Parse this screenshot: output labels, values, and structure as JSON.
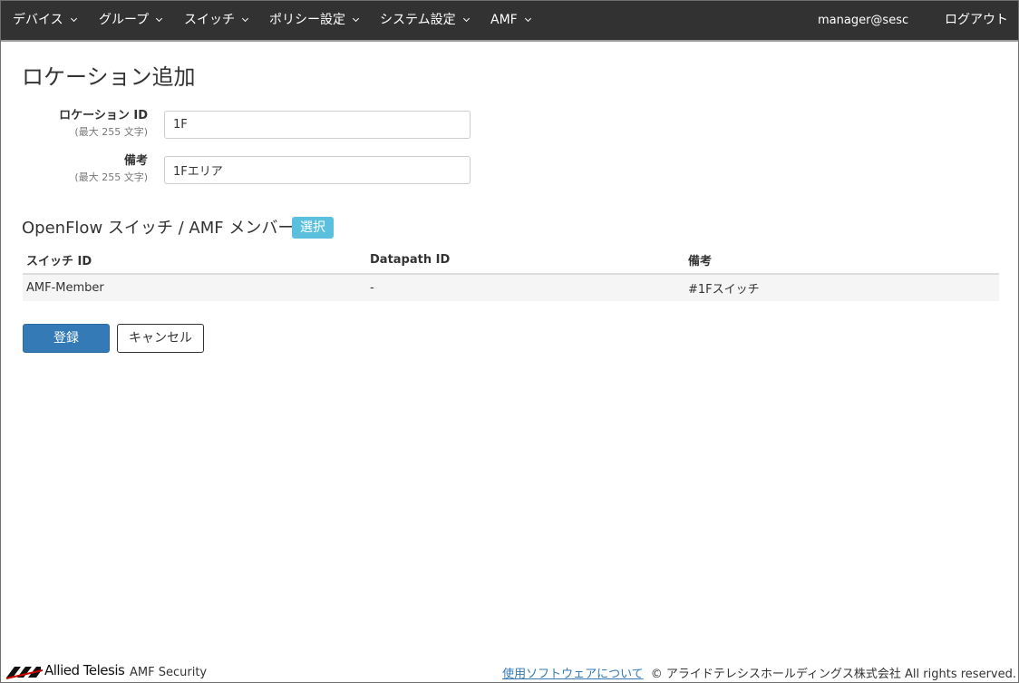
{
  "nav": {
    "items": [
      {
        "label": "デバイス"
      },
      {
        "label": "グループ"
      },
      {
        "label": "スイッチ"
      },
      {
        "label": "ポリシー設定"
      },
      {
        "label": "システム設定"
      },
      {
        "label": "AMF"
      }
    ],
    "user": "manager@sesc",
    "logout": "ログアウト"
  },
  "page": {
    "title": "ロケーション追加"
  },
  "form": {
    "location_id": {
      "label": "ロケーション ID",
      "hint": "(最大 255 文字)",
      "value": "1F"
    },
    "remarks": {
      "label": "備考",
      "hint": "(最大 255 文字)",
      "value": "1Fエリア"
    }
  },
  "members": {
    "title": "OpenFlow スイッチ / AMF メンバー",
    "select_label": "選択",
    "columns": [
      "スイッチ ID",
      "Datapath ID",
      "備考"
    ],
    "rows": [
      [
        "AMF-Member",
        "-",
        "#1Fスイッチ"
      ]
    ]
  },
  "actions": {
    "submit_label": "登録",
    "cancel_label": "キャンセル"
  },
  "footer": {
    "brand": "Allied Telesis",
    "product": "AMF Security",
    "link": "使用ソフトウェアについて",
    "copyright": "© アライドテレシスホールディングス株式会社 All rights reserved."
  },
  "colors": {
    "navbar": "#333232",
    "primary": "#337ab7",
    "badge": "#5bc0de"
  }
}
